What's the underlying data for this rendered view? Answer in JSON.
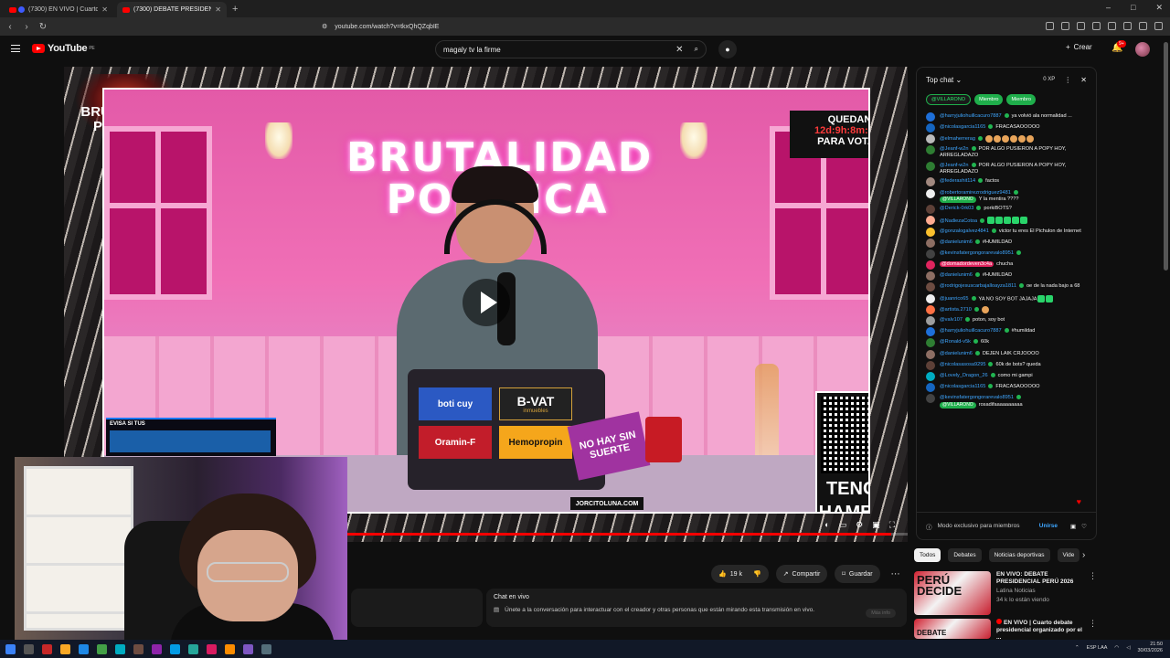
{
  "browser": {
    "tabs": [
      {
        "label": "(7300) EN VIVO | Cuarto debate presidencial",
        "active": false
      },
      {
        "label": "(7300) DEBATE PRESIDENCIAL 2026",
        "active": true
      }
    ],
    "url": "youtube.com/watch?v=tkxQhQZqbIE",
    "window_controls": [
      "–",
      "□",
      "✕"
    ]
  },
  "youtube_header": {
    "logo_text": "YouTube",
    "logo_region": "PE",
    "search_value": "magaly tv la firme",
    "create_label": "Crear",
    "notif_count": "9+"
  },
  "video": {
    "show_logo": "BRUTALIDAD POLÍTICA",
    "set_title_line1": "BRUTALIDAD",
    "set_title_line2": "POLÍTICA",
    "countdown": {
      "top": "QUEDAN",
      "time": "12d:9h:8m:54s",
      "bottom": "PARA VOTAR"
    },
    "qr_caption_1": "TENGO",
    "qr_caption_2": "HAMBRE",
    "stickers": {
      "boti": "boti cuy",
      "bvat": "B-VAT",
      "bvat_sub": "inmuebles",
      "oramin": "Oramin-F",
      "hemo": "Hemopropin",
      "no_hay": "NO HAY SIN SUERTE",
      "jorcito": "JORCITOLUNA.COM"
    },
    "evisa_text": "EVISA SI TUS",
    "progress_fraction": 0.98
  },
  "actions": {
    "likes": "19 k",
    "share_label": "Compartir",
    "save_label": "Guardar"
  },
  "live_chat_box": {
    "title": "Chat en vivo",
    "text": "Únete a la conversación para interactuar con el creador y otras personas que están mirando esta transmisión en vivo.",
    "button": "Más info"
  },
  "chat": {
    "header": "Top chat",
    "xp": "0 XP",
    "pinned": [
      "@VILLARONO",
      "Miembro",
      "Miembro"
    ],
    "messages": [
      {
        "author": "@harryjuliohuillcacuro7887",
        "text": "ya volvió ala normalidad ...",
        "av": "#1e6fd9",
        "style": "blue"
      },
      {
        "author": "@nicolasgarcia1165",
        "text": "FRACASAOOOOO",
        "av": "#1565c0",
        "style": "blue"
      },
      {
        "author": "@elmaherrerag",
        "text": "",
        "emojis": 6,
        "av": "#bbbbbb",
        "style": "blue"
      },
      {
        "author": "@Jeanf-w2n",
        "text": "POR ALGO PUSIERON A POPY HOY, ARREGLADAZO",
        "av": "#2e7d32",
        "style": "blue"
      },
      {
        "author": "@Jeanf-w2n",
        "text": "POR ALGO PUSIERON A POPY HOY, ARREGLADAZO",
        "av": "#2e7d32",
        "style": "blue"
      },
      {
        "author": "@federashit114",
        "text": "factos",
        "av": "#a1887f",
        "style": "blue"
      },
      {
        "author": "@robertoramirezrodriguez9481",
        "text": "Y la mentira ????",
        "badge": "@VILLARONO",
        "av": "#eeeeee",
        "style": "blue"
      },
      {
        "author": "@Derick-0rk03",
        "text": "porkiBOTS?",
        "av": "#5d4037",
        "style": "blue"
      },
      {
        "author": "@NadiezaCotoa",
        "text": "",
        "gemojis": 5,
        "av": "#ffab91",
        "style": "blue"
      },
      {
        "author": "@gonzalogalvez4841",
        "text": "victor tu eres El Pichulon de Internet",
        "av": "#fbc02d",
        "style": "blue"
      },
      {
        "author": "@danielunim6",
        "text": "#HUMILDAD",
        "av": "#8d6e63",
        "style": "blue"
      },
      {
        "author": "@kevinsfatergongorarevalo8951",
        "text": "",
        "av": "#424242",
        "style": "blue"
      },
      {
        "author": "@domadordeven3c4a",
        "text": "chucha",
        "av": "#e0245e",
        "style": "pink"
      },
      {
        "author": "@danielunim6",
        "text": "#HUMILDAD",
        "av": "#8d6e63",
        "style": "blue"
      },
      {
        "author": "@rodrigojesuscarbajalloayza1811",
        "text": "oe de la nada bajo a 68",
        "av": "#6d4c41",
        "style": "blue"
      },
      {
        "author": "@juanrico65",
        "text": "YA NO SOY BOT JAJAJA",
        "gemojis": 2,
        "av": "#eeeeee",
        "style": "blue"
      },
      {
        "author": "@artista.2710",
        "text": "",
        "emojis": 1,
        "av": "#ff7043",
        "style": "blue"
      },
      {
        "author": "@valv107",
        "text": "poton, soy bot",
        "av": "#9e9e9e",
        "style": "blue"
      },
      {
        "author": "@harryjuliohuillcacuro7887",
        "text": "#humildad",
        "av": "#1e6fd9",
        "style": "blue"
      },
      {
        "author": "@Ronald-v5k",
        "text": "60k",
        "av": "#2e7d32",
        "style": "blue"
      },
      {
        "author": "@danielunim6",
        "text": "DEJEN LAIK CRJOOOO",
        "av": "#8d6e63",
        "style": "blue"
      },
      {
        "author": "@nicolasasosa9295",
        "text": "60k de bots? queda",
        "av": "#5d4037",
        "style": "blue"
      },
      {
        "author": "@Lovely_Dragon_26",
        "text": "como mi gampi",
        "av": "#00acc1",
        "style": "blue"
      },
      {
        "author": "@nicolasgarcia1165",
        "text": "FRACASAOOOOO",
        "av": "#1565c0",
        "style": "blue"
      },
      {
        "author": "@kevinsfatergongorarevalo8951",
        "text": "rosadifaaaaaaaaaa",
        "badge": "@VILLARONO",
        "av": "#424242",
        "style": "blue"
      }
    ],
    "footer_label": "Modo exclusivo para miembros",
    "footer_join": "Unirse"
  },
  "chips": [
    "Todos",
    "Debates",
    "Noticias deportivas",
    "Vide"
  ],
  "recommendations": [
    {
      "thumb": "PERÚ DECIDE",
      "title": "EN VIVO: DEBATE PRESIDENCIAL PERÚ 2026",
      "channel": "Latina Noticias",
      "meta": "34 k lo están viendo",
      "live": false
    },
    {
      "thumb": "DEBATE",
      "title": "EN VIVO | Cuarto debate presidencial organizado por el ...",
      "channel": "",
      "meta": "",
      "live": true
    }
  ],
  "taskbar": {
    "lang": "ESP LAA",
    "time": "21:50",
    "date": "30/03/2026"
  },
  "colors": {
    "yt_red": "#ff0000",
    "member_green": "#1fae4b",
    "link_blue": "#3ea6ff",
    "set_pink": "#e35aa8"
  }
}
